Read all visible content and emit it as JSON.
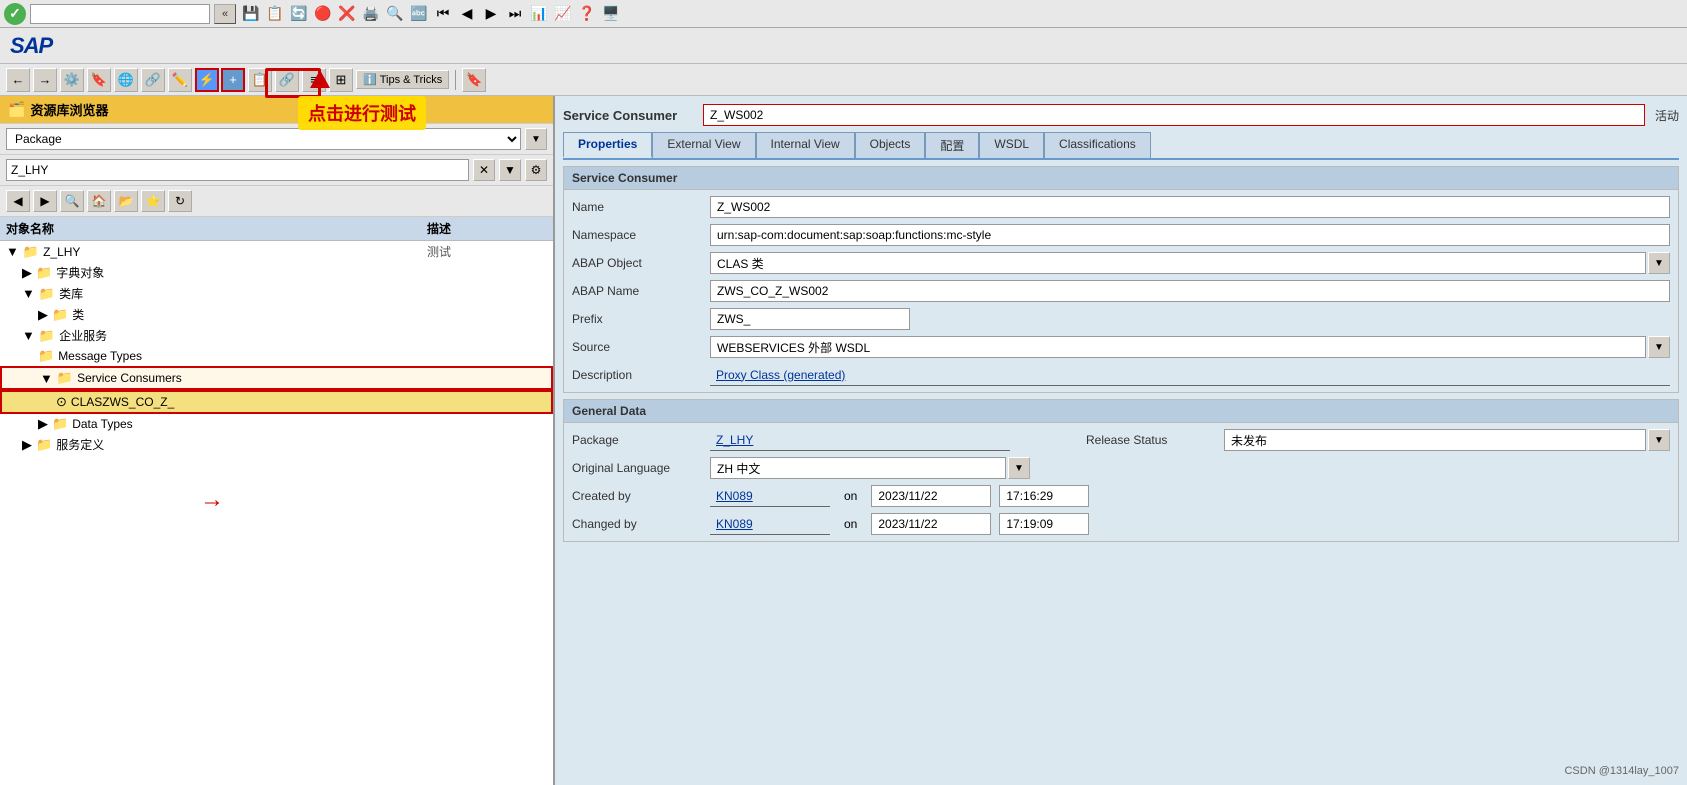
{
  "systemBar": {
    "inputValue": "",
    "collapseBtn": "«"
  },
  "sapHeader": {
    "logo": "SAP"
  },
  "toolbar": {
    "tipsAndTricks": "Tips & Tricks"
  },
  "leftPanel": {
    "title": "资源库浏览器",
    "filterLabel": "Package",
    "searchValue": "Z_LHY",
    "treeHeader": {
      "col1": "对象名称",
      "col2": "描述"
    },
    "annotation": "点击进行测试",
    "treeItems": [
      {
        "id": "z_lhy",
        "indent": 0,
        "icon": "▶📁",
        "label": "Z_LHY",
        "desc": "测试",
        "hasArrow": true
      },
      {
        "id": "dict",
        "indent": 1,
        "icon": "▶📁",
        "label": "字典对象",
        "desc": "",
        "hasArrow": true
      },
      {
        "id": "classlib",
        "indent": 1,
        "icon": "▶📁",
        "label": "类库",
        "desc": "",
        "hasArrow": true
      },
      {
        "id": "class",
        "indent": 2,
        "icon": "▶📁",
        "label": "类",
        "desc": "",
        "hasArrow": true
      },
      {
        "id": "enterprise",
        "indent": 1,
        "icon": "▶📁",
        "label": "企业服务",
        "desc": "",
        "hasArrow": true
      },
      {
        "id": "msgtypes",
        "indent": 2,
        "icon": "📁",
        "label": "Message Types",
        "desc": "",
        "hasArrow": false
      },
      {
        "id": "svccons",
        "indent": 2,
        "icon": "📁",
        "label": "Service Consumers",
        "desc": "",
        "hasArrow": false,
        "highlighted": true
      },
      {
        "id": "claszws",
        "indent": 3,
        "icon": "⊙",
        "label": "CLASZWS_CO_Z_",
        "desc": "",
        "hasArrow": false,
        "selected": true
      },
      {
        "id": "datatypes",
        "indent": 2,
        "icon": "▶📁",
        "label": "Data Types",
        "desc": "",
        "hasArrow": true
      },
      {
        "id": "svcdef",
        "indent": 1,
        "icon": "▶📁",
        "label": "服务定义",
        "desc": "",
        "hasArrow": true
      }
    ]
  },
  "rightPanel": {
    "serviceConsumerLabel": "Service Consumer",
    "serviceConsumerValue": "Z_WS002",
    "statusLabel": "活动",
    "tabs": [
      {
        "id": "properties",
        "label": "Properties",
        "active": true
      },
      {
        "id": "externalview",
        "label": "External View",
        "active": false
      },
      {
        "id": "internalview",
        "label": "Internal View",
        "active": false
      },
      {
        "id": "objects",
        "label": "Objects",
        "active": false
      },
      {
        "id": "config",
        "label": "配置",
        "active": false
      },
      {
        "id": "wsdl",
        "label": "WSDL",
        "active": false
      },
      {
        "id": "classifications",
        "label": "Classifications",
        "active": false
      }
    ],
    "serviceConsumerSection": {
      "title": "Service Consumer",
      "fields": [
        {
          "id": "name",
          "label": "Name",
          "value": "Z_WS002",
          "type": "text"
        },
        {
          "id": "namespace",
          "label": "Namespace",
          "value": "urn:sap-com:document:sap:soap:functions:mc-style",
          "type": "text"
        },
        {
          "id": "abapObject",
          "label": "ABAP Object",
          "value": "CLAS 类",
          "type": "dropdown"
        },
        {
          "id": "abapName",
          "label": "ABAP Name",
          "value": "ZWS_CO_Z_WS002",
          "type": "text"
        },
        {
          "id": "prefix",
          "label": "Prefix",
          "value": "ZWS_",
          "type": "text",
          "narrow": true
        },
        {
          "id": "source",
          "label": "Source",
          "value": "WEBSERVICES 外部 WSDL",
          "type": "dropdown"
        },
        {
          "id": "description",
          "label": "Description",
          "value": "Proxy Class (generated)",
          "type": "link"
        }
      ]
    },
    "generalDataSection": {
      "title": "General Data",
      "leftFields": [
        {
          "id": "package",
          "label": "Package",
          "value": "Z_LHY",
          "type": "link"
        },
        {
          "id": "origLang",
          "label": "Original Language",
          "value": "ZH 中文",
          "type": "dropdown"
        },
        {
          "id": "createdBy",
          "label": "Created by",
          "value": "KN089",
          "type": "link",
          "on": "on",
          "date": "2023/11/22",
          "time": "17:16:29"
        },
        {
          "id": "changedBy",
          "label": "Changed by",
          "value": "KN089",
          "type": "link",
          "on": "on",
          "date": "2023/11/22",
          "time": "17:19:09"
        }
      ],
      "rightFields": [
        {
          "id": "releaseStatus",
          "label": "Release Status",
          "value": "未发布",
          "type": "dropdown"
        }
      ]
    }
  },
  "watermark": "CSDN @1314lay_1007"
}
